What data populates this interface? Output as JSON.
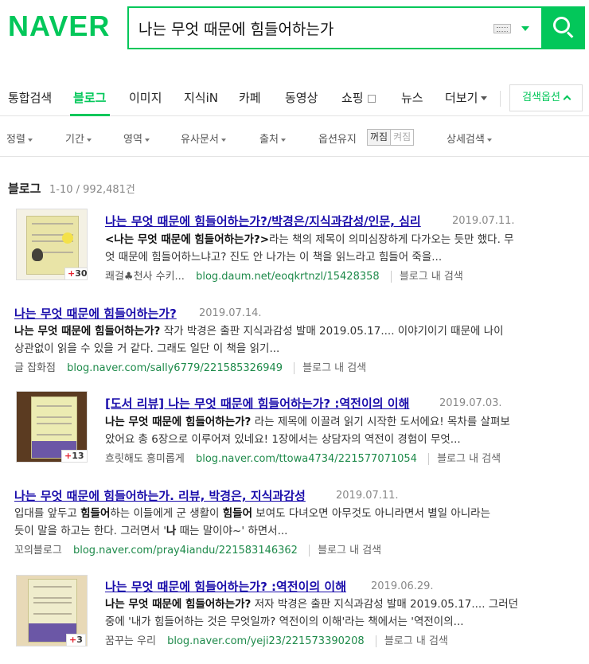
{
  "brand": {
    "logo": "NAVER",
    "color": "#03c75a"
  },
  "search": {
    "query": "나는 무엇 때문에 힘들어하는가"
  },
  "tabs": [
    {
      "label": "통합검색"
    },
    {
      "label": "블로그"
    },
    {
      "label": "이미지"
    },
    {
      "label": "지식iN"
    },
    {
      "label": "카페"
    },
    {
      "label": "동영상"
    },
    {
      "label": "쇼핑"
    },
    {
      "label": "뉴스"
    },
    {
      "label": "더보기"
    }
  ],
  "search_options_label": "검색옵션",
  "filters": [
    {
      "label": "정렬"
    },
    {
      "label": "기간"
    },
    {
      "label": "영역"
    },
    {
      "label": "유사문서"
    },
    {
      "label": "출처"
    },
    {
      "label": "옵션유지"
    },
    {
      "label": "상세검색"
    }
  ],
  "keep_toggle": {
    "on": "꺼짐",
    "off": "켜짐"
  },
  "section": {
    "title": "블로그",
    "count": "1-10 / 992,481건"
  },
  "results": [
    {
      "title": "나는 무엇 때문에 힘들어하는가?/박경은/지식과감성/인문, 심리",
      "date": "2019.07.11.",
      "desc_line1_bold": "<나는 무엇 때문에 힘들어하는가?>",
      "desc_line1_rest": "라는 책의 제목이 의미심장하게 다가오는 듯만 했다. 무",
      "desc_line2": "엇 때문에 힘들어하느냐고? 진도 안 나가는 이 책을 읽느라고 힘들어 죽을...",
      "author_icon": "♣",
      "author": "쾌걸♣천사 수키...",
      "url": "blog.daum.net/eoqkrtnzl/15428358",
      "in_blog": "블로그 내 검색",
      "badge": "30"
    },
    {
      "title": "나는 무엇 때문에 힘들어하는가?",
      "date": "2019.07.14.",
      "desc_line1_bold": "나는 무엇 때문에 힘들어하는가?",
      "desc_line1_rest": " 작가 박경은 출판 지식과감성 발매 2019.05.17.... 이야기이기 때문에 나이",
      "desc_line2": "상관없이 읽을 수 있을 거 같다. 그래도 일단 이 책을 읽기...",
      "author": "글 잡화점",
      "url": "blog.naver.com/sally6779/221585326949",
      "in_blog": "블로그 내 검색"
    },
    {
      "title": "[도서 리뷰] 나는 무엇 때문에 힘들어하는가? :역전이의 이해",
      "date": "2019.07.03.",
      "desc_line1_bold": "나는 무엇 때문에 힘들어하는가?",
      "desc_line1_rest": " 라는 제목에 이끌려 읽기 시작한 도서에요! 목차를 살펴보",
      "desc_line2": "았어요 총 6장으로 이루어져 있네요! 1장에서는 상담자의 역전이 경험이 무엇...",
      "author": "흐릿해도 흥미롭게",
      "url": "blog.naver.com/ttowa4734/221577071054",
      "in_blog": "블로그 내 검색",
      "badge": "13"
    },
    {
      "title": "나는 무엇 때문에 힘들어하는가. 리뷰, 박경은, 지식과감성",
      "date": "2019.07.11.",
      "desc_line1_pre": "입대를 앞두고 ",
      "desc_line1_bold": "힘들어",
      "desc_line1_mid": "하는 이들에게 군 생활이 ",
      "desc_line1_bold2": "힘들어",
      "desc_line1_rest": " 보여도 다녀오면 아무것도 아니라면서 별일 아니라는",
      "desc_line2_pre": "듯이 말을 하고는 한다. 그러면서 '",
      "desc_line2_bold": "나",
      "desc_line2_rest": " 때는 말이야~' 하면서...",
      "author": "꼬의블로그",
      "url": "blog.naver.com/pray4iandu/221583146362",
      "in_blog": "블로그 내 검색"
    },
    {
      "title": "나는 무엇 때문에 힘들어하는가? :역전이의 이해",
      "date": "2019.06.29.",
      "desc_line1_bold": "나는 무엇 때문에 힘들어하는가?",
      "desc_line1_rest": " 저자 박경은 출판 지식과감성 발매 2019.05.17.... 그러던",
      "desc_line2": "중에 '내가 힘들어하는 것은 무엇일까? 역전이의 이해'라는 책에서는 '역전이의...",
      "author": "꿈꾸는 우리",
      "url": "blog.naver.com/yeji23/221573390208",
      "in_blog": "블로그 내 검색",
      "badge": "3"
    }
  ]
}
